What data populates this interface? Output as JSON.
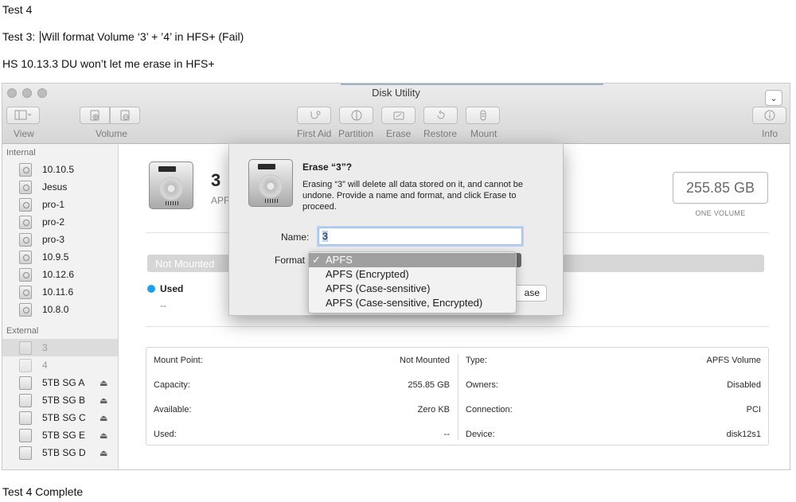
{
  "notes": {
    "line1": "Test 4",
    "line2_before_caret": "Test 3: ",
    "line2_after_caret": "Will format Volume ‘3’ + ’4’ in HFS+ (Fail)",
    "line3": "HS 10.13.3 DU won’t let me erase in HFS+",
    "line4": "Test 4 Complete"
  },
  "window": {
    "title": "Disk Utility",
    "toolbar": {
      "view_label": "View",
      "volume_label": "Volume",
      "first_aid_label": "First Aid",
      "partition_label": "Partition",
      "erase_label": "Erase",
      "restore_label": "Restore",
      "mount_label": "Mount",
      "info_label": "Info"
    }
  },
  "sidebar": {
    "internal_header": "Internal",
    "internal_items": [
      "10.10.5",
      "Jesus",
      "pro-1",
      "pro-2",
      "pro-3",
      "10.9.5",
      "10.12.6",
      "10.11.6",
      "10.8.0"
    ],
    "external_header": "External",
    "external_items": [
      {
        "label": "3",
        "selected": true,
        "dim": true,
        "eject": false
      },
      {
        "label": "4",
        "selected": false,
        "dim": true,
        "eject": false
      },
      {
        "label": "5TB SG A",
        "selected": false,
        "dim": false,
        "eject": true
      },
      {
        "label": "5TB SG B",
        "selected": false,
        "dim": false,
        "eject": true
      },
      {
        "label": "5TB SG C",
        "selected": false,
        "dim": false,
        "eject": true
      },
      {
        "label": "5TB SG E",
        "selected": false,
        "dim": false,
        "eject": true
      },
      {
        "label": "5TB SG D",
        "selected": false,
        "dim": false,
        "eject": true
      }
    ],
    "eject_glyph": "⏏"
  },
  "main": {
    "volume_name": "3",
    "volume_type_partial": "APF",
    "size": "255.85 GB",
    "size_sub": "ONE VOLUME",
    "usage_bar_label": "Not Mounted",
    "legend": {
      "label": "Used",
      "value": "--",
      "color": "#1aa0ef"
    },
    "info": {
      "left": [
        {
          "label": "Mount Point:",
          "value": "Not Mounted"
        },
        {
          "label": "Capacity:",
          "value": "255.85 GB"
        },
        {
          "label": "Available:",
          "value": "Zero KB"
        },
        {
          "label": "Used:",
          "value": "--"
        }
      ],
      "right": [
        {
          "label": "Type:",
          "value": "APFS Volume"
        },
        {
          "label": "Owners:",
          "value": "Disabled"
        },
        {
          "label": "Connection:",
          "value": "PCI"
        },
        {
          "label": "Device:",
          "value": "disk12s1"
        }
      ]
    }
  },
  "dialog": {
    "title": "Erase “3”?",
    "message": "Erasing “3” will delete all data stored on it, and cannot be undone. Provide a name and format, and click Erase to proceed.",
    "name_label": "Name:",
    "name_value": "3",
    "format_label": "Format",
    "erase_button_visible": "ase",
    "format_options": [
      {
        "label": "APFS",
        "checked": true
      },
      {
        "label": "APFS (Encrypted)",
        "checked": false
      },
      {
        "label": "APFS (Case-sensitive)",
        "checked": false
      },
      {
        "label": "APFS (Case-sensitive, Encrypted)",
        "checked": false
      }
    ],
    "check_glyph": "✓"
  }
}
